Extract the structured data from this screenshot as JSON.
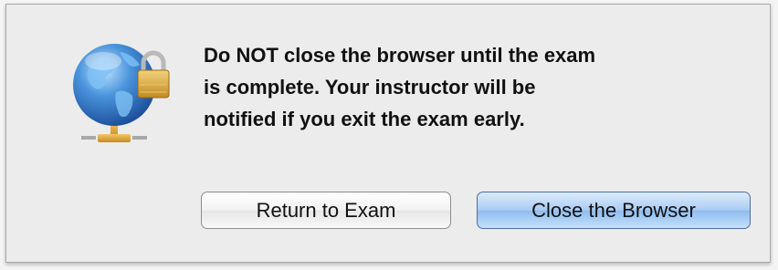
{
  "dialog": {
    "message": "Do NOT close the browser until the exam\nis complete.  Your instructor will be\nnotified if you exit the exam early.",
    "icon": "globe-lock-icon",
    "buttons": {
      "return_label": "Return to Exam",
      "close_label": "Close the Browser"
    }
  },
  "colors": {
    "dialog_background": "#ececec",
    "default_button": "#a9ccf2"
  }
}
